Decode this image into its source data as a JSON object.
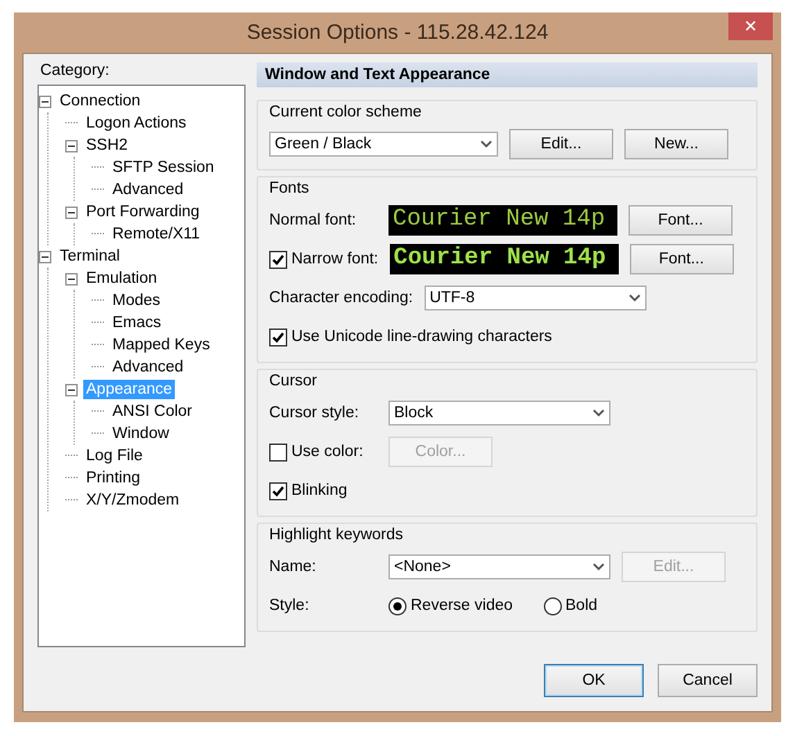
{
  "window": {
    "title": "Session Options - 115.28.42.124",
    "close": "✕"
  },
  "category_label": "Category:",
  "tree": [
    {
      "label": "Connection",
      "expanded": true,
      "selected": false,
      "children": [
        {
          "label": "Logon Actions",
          "selected": false
        },
        {
          "label": "SSH2",
          "expanded": true,
          "selected": false,
          "children": [
            {
              "label": "SFTP Session",
              "selected": false
            },
            {
              "label": "Advanced",
              "selected": false
            }
          ]
        },
        {
          "label": "Port Forwarding",
          "expanded": true,
          "selected": false,
          "children": [
            {
              "label": "Remote/X11",
              "selected": false
            }
          ]
        }
      ]
    },
    {
      "label": "Terminal",
      "expanded": true,
      "selected": false,
      "children": [
        {
          "label": "Emulation",
          "expanded": true,
          "selected": false,
          "children": [
            {
              "label": "Modes",
              "selected": false
            },
            {
              "label": "Emacs",
              "selected": false
            },
            {
              "label": "Mapped Keys",
              "selected": false
            },
            {
              "label": "Advanced",
              "selected": false
            }
          ]
        },
        {
          "label": "Appearance",
          "expanded": true,
          "selected": true,
          "children": [
            {
              "label": "ANSI Color",
              "selected": false
            },
            {
              "label": "Window",
              "selected": false
            }
          ]
        },
        {
          "label": "Log File",
          "selected": false
        },
        {
          "label": "Printing",
          "selected": false
        },
        {
          "label": "X/Y/Zmodem",
          "selected": false
        }
      ]
    }
  ],
  "panel_title": "Window and Text Appearance",
  "sections": [
    {
      "title": "Current color scheme",
      "rows": [
        [
          {
            "kind": "dropdown",
            "value": "Green / Black"
          },
          {
            "kind": "button",
            "label": "Edit...",
            "disabled": false
          },
          {
            "kind": "button",
            "label": "New...",
            "disabled": false
          }
        ]
      ]
    },
    {
      "title": "Fonts",
      "rows": [
        [
          {
            "kind": "label",
            "text": "Normal font:"
          },
          {
            "kind": "preview",
            "text": "Courier New 14p",
            "bold": false
          },
          {
            "kind": "button",
            "label": "Font...",
            "disabled": false
          }
        ],
        [
          {
            "kind": "checkbox",
            "label": "Narrow font:",
            "checked": true
          },
          {
            "kind": "preview",
            "text": "Courier New 14p",
            "bold": true
          },
          {
            "kind": "button",
            "label": "Font...",
            "disabled": false
          }
        ],
        [
          {
            "kind": "label",
            "text": "Character encoding:"
          },
          {
            "kind": "dropdown",
            "value": "UTF-8"
          }
        ],
        [
          {
            "kind": "checkbox",
            "label": "Use Unicode line-drawing characters",
            "checked": true
          }
        ]
      ]
    },
    {
      "title": "Cursor",
      "rows": [
        [
          {
            "kind": "label",
            "text": "Cursor style:"
          },
          {
            "kind": "dropdown",
            "value": "Block"
          }
        ],
        [
          {
            "kind": "checkbox",
            "label": "Use color:",
            "checked": false
          },
          {
            "kind": "button",
            "label": "Color...",
            "disabled": true
          }
        ],
        [
          {
            "kind": "checkbox",
            "label": "Blinking",
            "checked": true
          }
        ]
      ]
    },
    {
      "title": "Highlight keywords",
      "rows": [
        [
          {
            "kind": "label",
            "text": "Name:"
          },
          {
            "kind": "dropdown",
            "value": "<None>"
          },
          {
            "kind": "button",
            "label": "Edit...",
            "disabled": true
          }
        ],
        [
          {
            "kind": "label",
            "text": "Style:"
          },
          {
            "kind": "radio",
            "label": "Reverse video",
            "selected": true
          },
          {
            "kind": "radio",
            "label": "Bold",
            "selected": false
          }
        ]
      ]
    }
  ],
  "buttons": [
    {
      "label": "OK",
      "default": true
    },
    {
      "label": "Cancel",
      "default": false
    }
  ]
}
